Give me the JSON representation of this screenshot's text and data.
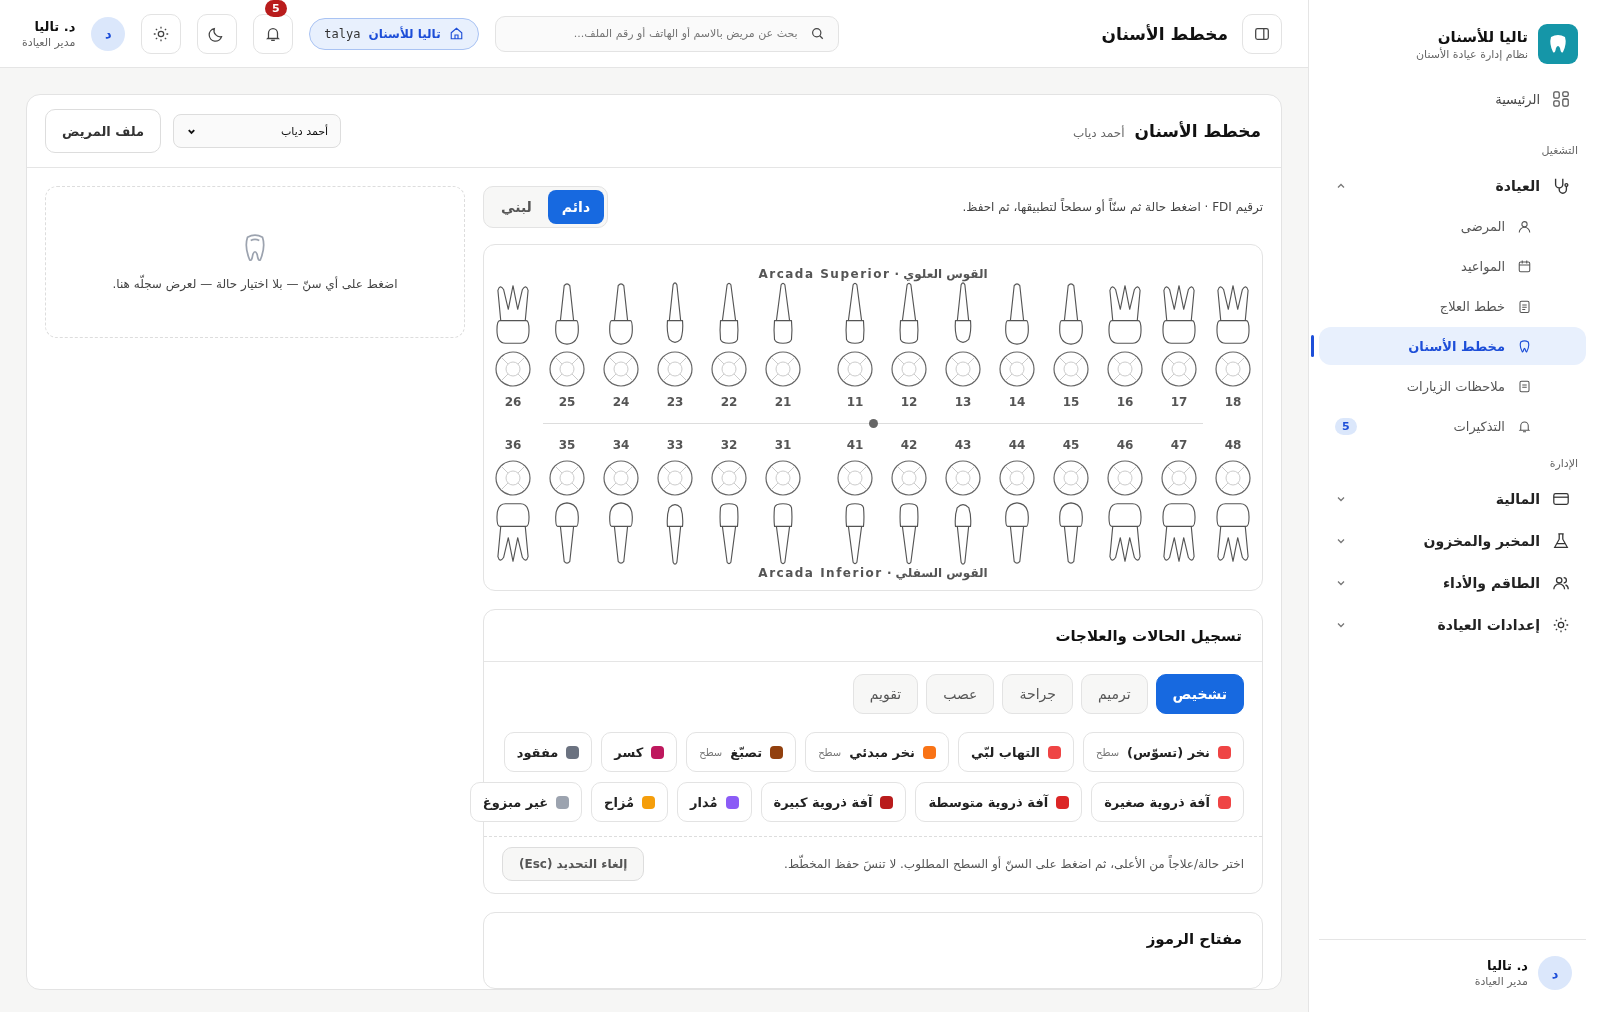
{
  "sidebar": {
    "brand": {
      "title": "تاليا للأسنان",
      "subtitle": "نظام إدارة عيادة الأسنان"
    },
    "home": {
      "label": "الرئيسية",
      "selected": false
    },
    "sections": [
      {
        "title": "التشغيل",
        "groups": [
          {
            "label": "العيادة",
            "expanded": true,
            "children": [
              {
                "label": "المرضى",
                "selected": false
              },
              {
                "label": "المواعيد",
                "selected": false
              },
              {
                "label": "خطط العلاج",
                "selected": false
              },
              {
                "label": "مخطط الأسنان",
                "selected": true
              },
              {
                "label": "ملاحظات الزيارات",
                "selected": false
              },
              {
                "label": "التذكيرات",
                "selected": false,
                "badge": "5"
              }
            ]
          }
        ]
      },
      {
        "title": "الإدارة",
        "groups": [
          {
            "label": "المالية",
            "expanded": false
          },
          {
            "label": "المخبر والمخزون",
            "expanded": false
          },
          {
            "label": "الطاقم والأداء",
            "expanded": false
          },
          {
            "label": "إعدادات العيادة",
            "expanded": false
          }
        ]
      }
    ],
    "user": {
      "avatar": "د",
      "name": "د. تاليا",
      "role": "مدير العيادة"
    }
  },
  "topbar": {
    "title": "مخطط الأسنان",
    "search": {
      "placeholder": "بحث عن مريض بالاسم أو الهاتف أو رقم الملف..."
    },
    "clinic": {
      "name": "تاليا للأسنان",
      "code": "talya"
    },
    "notifications": "5",
    "user": {
      "avatar": "د",
      "name": "د. تاليا",
      "role": "مدير العيادة"
    }
  },
  "page": {
    "title": "مخطط الأسنان",
    "patient": "أحمد دياب",
    "patient_select": "أحمد دياب",
    "profile_button": "ملف المريض"
  },
  "hint": "ترقيم FDI · اضغط حالة ثم سنّاً أو سطحاً لتطبيقها، ثم احفظ.",
  "dentition": [
    {
      "label": "دائم",
      "selected": true
    },
    {
      "label": "لبني",
      "selected": false
    }
  ],
  "chart": {
    "upper": {
      "label": "القوس العلوي · Arcada Superior",
      "right": [
        {
          "number": "18",
          "kind": "molar"
        },
        {
          "number": "17",
          "kind": "molar"
        },
        {
          "number": "16",
          "kind": "molar"
        },
        {
          "number": "15",
          "kind": "premolar"
        },
        {
          "number": "14",
          "kind": "premolar"
        },
        {
          "number": "13",
          "kind": "canine"
        },
        {
          "number": "12",
          "kind": "incisor"
        },
        {
          "number": "11",
          "kind": "incisor"
        }
      ],
      "left": [
        {
          "number": "21",
          "kind": "incisor"
        },
        {
          "number": "22",
          "kind": "incisor"
        },
        {
          "number": "23",
          "kind": "canine"
        },
        {
          "number": "24",
          "kind": "premolar"
        },
        {
          "number": "25",
          "kind": "premolar"
        },
        {
          "number": "26",
          "kind": "molar"
        }
      ]
    },
    "lower": {
      "label": "القوس السفلي · Arcada Inferior",
      "right": [
        {
          "number": "48",
          "kind": "molar"
        },
        {
          "number": "47",
          "kind": "molar"
        },
        {
          "number": "46",
          "kind": "molar"
        },
        {
          "number": "45",
          "kind": "premolar"
        },
        {
          "number": "44",
          "kind": "premolar"
        },
        {
          "number": "43",
          "kind": "canine"
        },
        {
          "number": "42",
          "kind": "incisor"
        },
        {
          "number": "41",
          "kind": "incisor"
        }
      ],
      "left": [
        {
          "number": "31",
          "kind": "incisor"
        },
        {
          "number": "32",
          "kind": "incisor"
        },
        {
          "number": "33",
          "kind": "canine"
        },
        {
          "number": "34",
          "kind": "premolar"
        },
        {
          "number": "35",
          "kind": "premolar"
        },
        {
          "number": "36",
          "kind": "molar"
        }
      ]
    }
  },
  "record_panel": {
    "text": "اضغط على أي سنّ — بلا اختيار حالة — لعرض سجلّه هنا."
  },
  "conditions": {
    "title": "تسجيل الحالات والعلاجات",
    "tabs": [
      {
        "label": "تشخيص",
        "selected": true
      },
      {
        "label": "ترميم",
        "selected": false
      },
      {
        "label": "جراحة",
        "selected": false
      },
      {
        "label": "عصب",
        "selected": false
      },
      {
        "label": "تقويم",
        "selected": false
      }
    ],
    "rows": [
      [
        {
          "label": "نخر (تسوّس)",
          "color": "#ef4444",
          "tag": "سطح"
        },
        {
          "label": "التهاب لبّي",
          "color": "#ef4444"
        },
        {
          "label": "نخر مبدئي",
          "color": "#f97316",
          "tag": "سطح"
        },
        {
          "label": "تصبّغ",
          "color": "#92400e",
          "tag": "سطح"
        },
        {
          "label": "كسر",
          "color": "#be185d"
        },
        {
          "label": "مفقود",
          "color": "#6b7280"
        }
      ],
      [
        {
          "label": "آفة ذروية صغيرة",
          "color": "#ef4444"
        },
        {
          "label": "آفة ذروية متوسطة",
          "color": "#dc2626"
        },
        {
          "label": "آفة ذروية كبيرة",
          "color": "#b91c1c"
        },
        {
          "label": "مُدار",
          "color": "#8b5cf6"
        },
        {
          "label": "مُزاح",
          "color": "#f59e0b"
        },
        {
          "label": "غير مبزوغ",
          "color": "#9ca3af"
        }
      ]
    ],
    "footer_hint": "اختر حالة/علاجاً من الأعلى، ثم اضغط على السنّ أو السطح المطلوب. لا تنسَ حفظ المخطّط.",
    "clear_button": "إلغاء التحديد (Esc)"
  },
  "legend": {
    "title": "مفتاح الرموز"
  }
}
